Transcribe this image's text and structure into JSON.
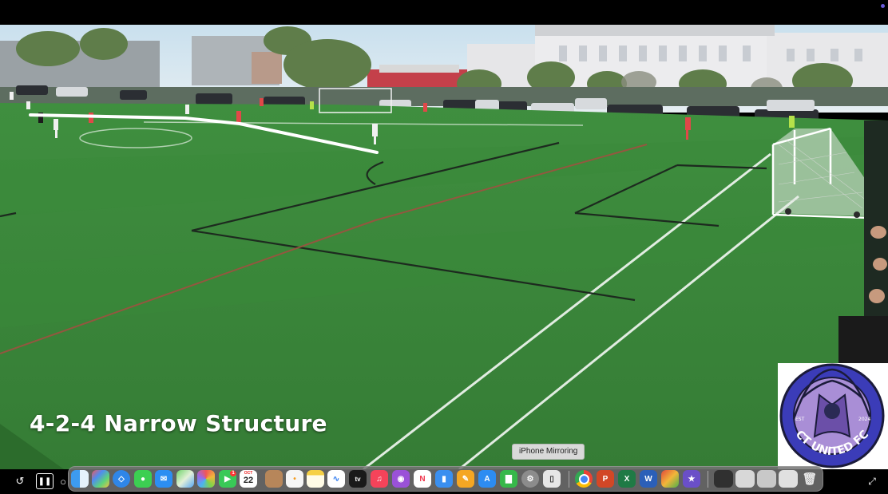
{
  "video": {
    "overlay_title": "4-2-4 Narrow Structure",
    "logo": {
      "text_top": "EST",
      "text_year": "2024",
      "text_name": "CT UNITED FC",
      "ring_color": "#3b3cb8",
      "inner_color": "#a98ed6"
    }
  },
  "tooltip": {
    "label": "iPhone Mirroring"
  },
  "controls": {
    "replay_icon": "replay-icon",
    "pause_icon": "pause-icon",
    "fullscreen_icon": "fullscreen-icon"
  },
  "dock": {
    "calendar_month": "OCT",
    "calendar_day": "22",
    "facetime_badge": "1",
    "appletv_label": "tv",
    "items": [
      "finder-icon",
      "launchpad-icon",
      "safari-icon",
      "messages-icon",
      "mail-icon",
      "maps-icon",
      "photos-icon",
      "facetime-icon",
      "calendar-icon",
      "contacts-icon",
      "reminders-icon",
      "notes-icon",
      "freeform-icon",
      "appletv-icon",
      "music-icon",
      "podcasts-icon",
      "news-icon",
      "keynote-icon",
      "pages-icon",
      "appstore-icon",
      "numbers-icon",
      "system-settings-icon",
      "iphone-mirroring-icon",
      "chrome-icon",
      "powerpoint-icon",
      "excel-icon",
      "word-icon",
      "puzzle-app-icon",
      "imovie-icon",
      "window-thumb-icon",
      "trash-icon"
    ]
  },
  "colors": {
    "pitch": "#3f8a3d",
    "pitch_dark": "#2f7432",
    "sky": "#cfe3f0",
    "dock_bg": "#737373",
    "white_line": "#ffffff"
  }
}
